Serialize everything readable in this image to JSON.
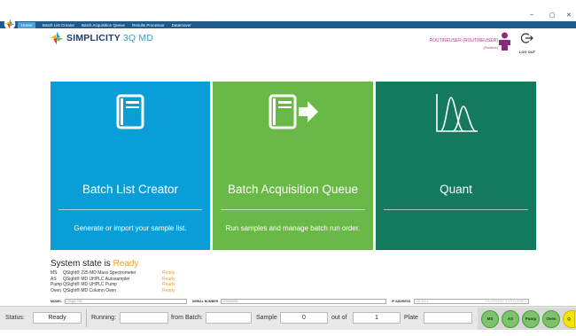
{
  "window": {
    "controls": [
      "–",
      "▢",
      "✕"
    ]
  },
  "menu": [
    "Home",
    "Batch List Creator",
    "Batch Acquisition Queue",
    "Results Processor",
    "Datamover"
  ],
  "brand": {
    "name_bold": "SIMPLICITY",
    "name_light": "3Q MD"
  },
  "user": {
    "name": "ROUTINEUSER (ROUTINEUSER)",
    "role": "(Routine)",
    "logout": "LOG OUT"
  },
  "tiles": [
    {
      "title": "Batch List Creator",
      "subtitle": "Generate or import your sample list.",
      "color": "#0a9ed9"
    },
    {
      "title": "Batch Acquisition Queue",
      "subtitle": "Run samples and manage batch run order.",
      "color": "#6ab845"
    },
    {
      "title": "Quant",
      "subtitle": "",
      "color": "#137a5e"
    }
  ],
  "system": {
    "heading": "System state is ",
    "state": "Ready",
    "rows": [
      {
        "key": "MS",
        "desc": "QSight® 225 MD Mass Spectrometer",
        "status": "Ready"
      },
      {
        "key": "AS",
        "desc": "QSight® MD UHPLC Autosampler",
        "status": "Ready"
      },
      {
        "key": "Pump",
        "desc": "QSight® MD UHPLC Pump",
        "status": "Ready"
      },
      {
        "key": "Oven",
        "desc": "QSight® MD Column Oven",
        "status": "Ready"
      }
    ]
  },
  "fields": {
    "model_label": "MODEL",
    "model_value": "QSight 225",
    "serial_label": "SERIAL NUMBER",
    "serial_value": "000000000",
    "ip_label": "IP ADDRESS",
    "ip_value": "127.0.0.1"
  },
  "watermark": "Activate Windows",
  "status": {
    "status_label": "Status:",
    "status_value": "Ready",
    "running_label": "Running:",
    "running_value": "",
    "from_batch_label": "from Batch:",
    "from_batch_value": "",
    "sample_label": "Sample",
    "sample_value": "0",
    "out_of_label": "out of",
    "out_of_value": "1",
    "plate_label": "Plate",
    "plate_value": ""
  },
  "indicators": [
    "MS",
    "AS",
    "Pump",
    "Oven",
    "Q"
  ]
}
